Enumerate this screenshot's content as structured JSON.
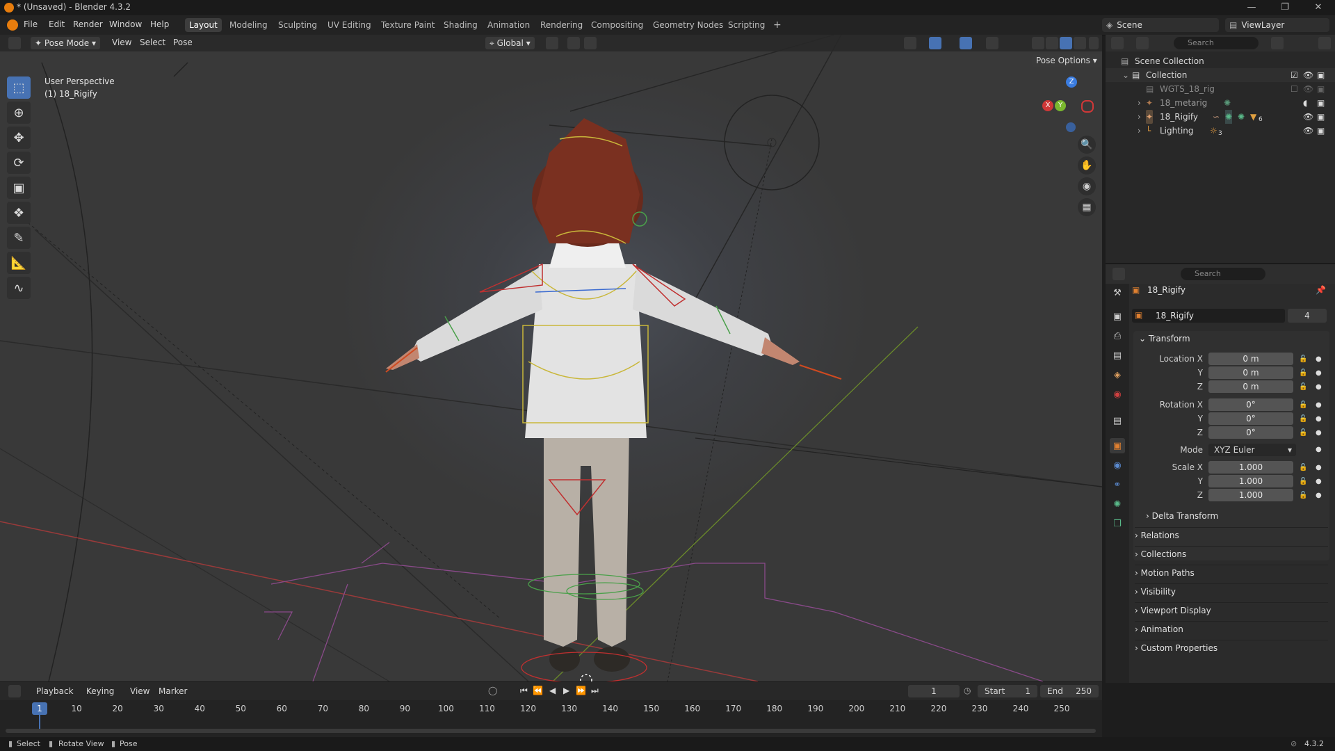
{
  "window": {
    "title": "* (Unsaved) - Blender 4.3.2",
    "controls": [
      "minimize-icon",
      "maximize-icon",
      "close-icon"
    ]
  },
  "menubar": {
    "menus": [
      "File",
      "Edit",
      "Render",
      "Window",
      "Help"
    ],
    "workspaces": [
      "Layout",
      "Modeling",
      "Sculpting",
      "UV Editing",
      "Texture Paint",
      "Shading",
      "Animation",
      "Rendering",
      "Compositing",
      "Geometry Nodes",
      "Scripting"
    ],
    "active_workspace": "Layout",
    "scene": "Scene",
    "view_layer": "ViewLayer"
  },
  "viewport_header": {
    "mode": "Pose Mode",
    "menus": [
      "View",
      "Select",
      "Pose"
    ],
    "orientation": "Global",
    "pose_options": "Pose Options"
  },
  "viewport": {
    "perspective": "User Perspective",
    "object_info": "(1) 18_Rigify",
    "gizmo_axes": [
      "X",
      "Y",
      "Z"
    ],
    "tools": [
      "select-box-icon",
      "cursor-icon",
      "move-icon",
      "rotate-icon",
      "scale-icon",
      "transform-icon",
      "annotate-icon",
      "measure-icon",
      "bone-envelope-icon"
    ],
    "active_tool": "select-box-icon",
    "navigation": [
      "zoom-icon",
      "pan-hand-icon",
      "camera-icon",
      "perspective-grid-icon"
    ]
  },
  "outliner": {
    "search_placeholder": "Search",
    "items": [
      {
        "name": "Scene Collection",
        "indent": 0,
        "icon": "scene-collection-icon"
      },
      {
        "name": "Collection",
        "indent": 1,
        "icon": "collection-icon"
      },
      {
        "name": "WGTS_18_rig",
        "indent": 2,
        "icon": "collection-icon"
      },
      {
        "name": "18_metarig",
        "indent": 2,
        "icon": "armature-icon"
      },
      {
        "name": "18_Rigify",
        "indent": 2,
        "icon": "armature-icon"
      },
      {
        "name": "Lighting",
        "indent": 2,
        "icon": "light-icon",
        "badge": "3"
      }
    ],
    "rigify_count": "6"
  },
  "properties": {
    "search_placeholder": "Search",
    "object_name": "18_Rigify",
    "datablock_name": "18_Rigify",
    "users": "4",
    "transform_header": "Transform",
    "location_label": "Location X",
    "rotation_label": "Rotation X",
    "scale_label": "Scale X",
    "axis_y": "Y",
    "axis_z": "Z",
    "location": [
      "0 m",
      "0 m",
      "0 m"
    ],
    "rotation": [
      "0°",
      "0°",
      "0°"
    ],
    "mode_label": "Mode",
    "mode": "XYZ Euler",
    "scale": [
      "1.000",
      "1.000",
      "1.000"
    ],
    "subpanels": [
      "Delta Transform",
      "Relations",
      "Collections",
      "Motion Paths",
      "Visibility",
      "Viewport Display",
      "Animation",
      "Custom Properties"
    ]
  },
  "timeline": {
    "menus": [
      "Playback",
      "Keying",
      "View",
      "Marker"
    ],
    "current_frame": "1",
    "start_label": "Start",
    "start": "1",
    "end_label": "End",
    "end": "250",
    "ruler": [
      "1",
      "10",
      "20",
      "30",
      "40",
      "50",
      "60",
      "70",
      "80",
      "90",
      "100",
      "110",
      "120",
      "130",
      "140",
      "150",
      "160",
      "170",
      "180",
      "190",
      "200",
      "210",
      "220",
      "230",
      "240",
      "250"
    ]
  },
  "statusbar": {
    "hints": [
      "Select",
      "Rotate View",
      "Pose"
    ],
    "version": "4.3.2"
  }
}
